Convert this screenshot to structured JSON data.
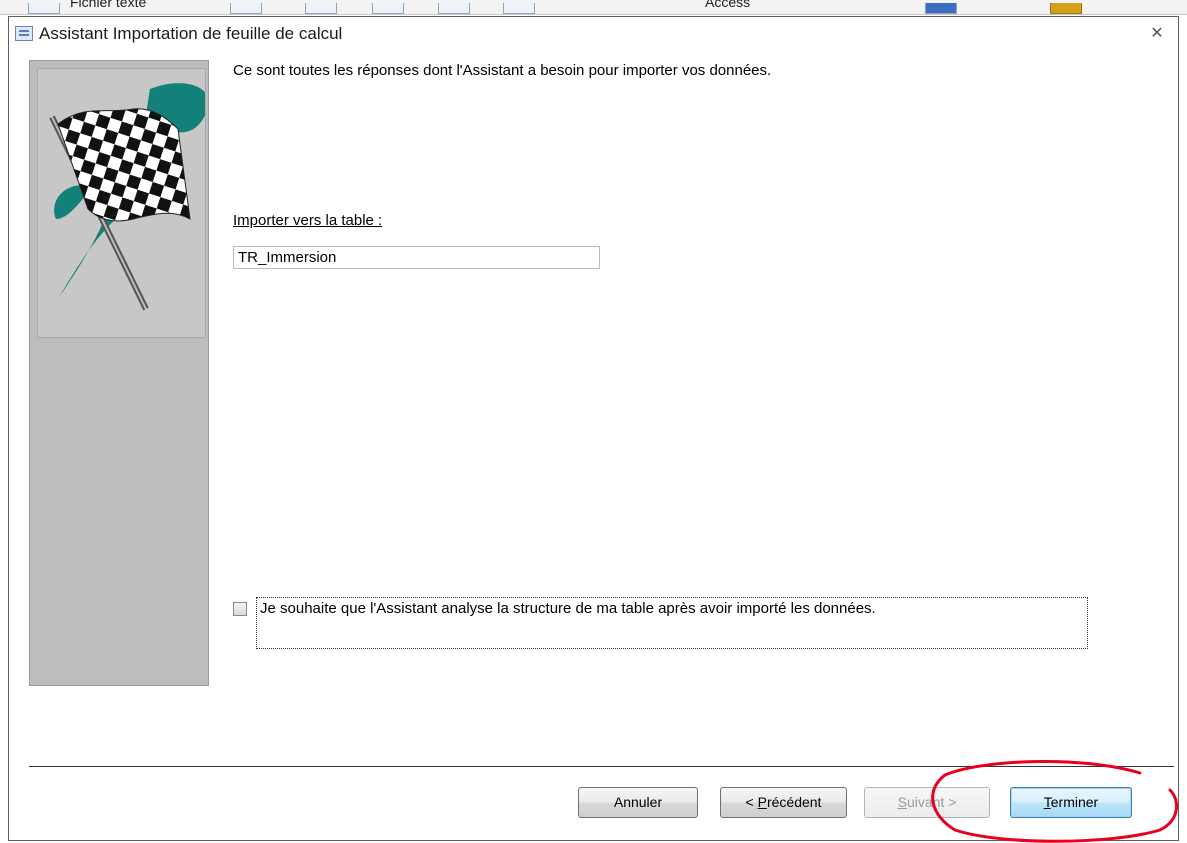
{
  "background": {
    "items": [
      "Fichier texte",
      "Access"
    ]
  },
  "dialog": {
    "title": "Assistant Importation de feuille de calcul",
    "close_glyph": "✕",
    "intro": "Ce sont toutes les réponses dont l'Assistant a besoin pour importer vos données.",
    "import_label": "Importer vers la table :",
    "table_name": "TR_Immersion",
    "analyze_label": "Je souhaite que l'Assistant analyse la structure de ma table après avoir importé les données.",
    "analyze_checked": false
  },
  "buttons": {
    "cancel": "Annuler",
    "prev_prefix": "< ",
    "prev_accel": "P",
    "prev_rest": "récédent",
    "next_accel": "S",
    "next_rest": "uivant >",
    "finish_accel": "T",
    "finish_rest": "erminer"
  },
  "colors": {
    "flag_swoosh": "#13807a",
    "annotation": "#e8001c",
    "default_button_border": "#3c7fb1"
  },
  "icons": {
    "title": "table-icon",
    "close": "close-icon",
    "illustration": "checkered-flag-icon"
  }
}
